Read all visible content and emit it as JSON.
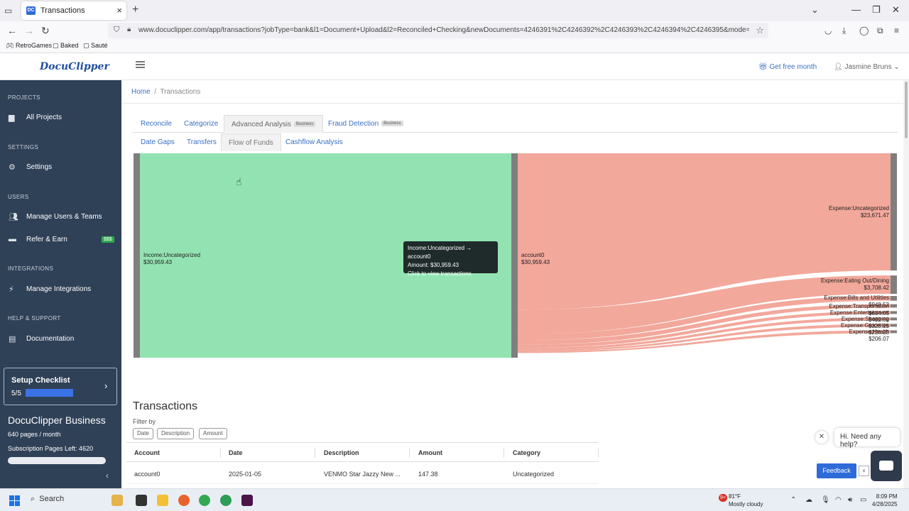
{
  "browser": {
    "tab_title": "Transactions",
    "tab_favicon": "DC",
    "url": "www.docuclipper.com/app/transactions?jobType=bank&l1=Document+Upload&l2=Reconciled+Checking&newDocuments=4246391%2C4246392%2C4246393%2C4246394%2C4246395&mode=analyze&analyze",
    "bookmarks": [
      "RetroGames",
      "Baked",
      "Sauté"
    ]
  },
  "header": {
    "logo": "DocuClipper",
    "get_free": "Get free month",
    "user": "Jasmine Bruns"
  },
  "sidebar": {
    "sections": [
      {
        "title": "PROJECTS",
        "items": [
          "All Projects"
        ]
      },
      {
        "title": "SETTINGS",
        "items": [
          "Settings"
        ]
      },
      {
        "title": "USERS",
        "items": [
          "Manage Users & Teams",
          "Refer & Earn"
        ]
      },
      {
        "title": "INTEGRATIONS",
        "items": [
          "Manage Integrations"
        ]
      },
      {
        "title": "HELP & SUPPORT",
        "items": [
          "Documentation"
        ]
      }
    ],
    "refer_badge": "$$$",
    "checklist_title": "Setup Checklist",
    "checklist_progress": "5/5",
    "checklist_fraction": 1.0,
    "plan_title": "DocuClipper Business",
    "plan_pages": "640 pages / month",
    "plan_left": "Subscription Pages Left: 4620"
  },
  "breadcrumb": {
    "home": "Home",
    "sep": "/",
    "current": "Transactions"
  },
  "tabs_primary": [
    {
      "label": "Reconcile",
      "badge": ""
    },
    {
      "label": "Categorize",
      "badge": ""
    },
    {
      "label": "Advanced Analysis",
      "badge": "Business"
    },
    {
      "label": "Fraud Detection",
      "badge": "Business"
    }
  ],
  "tabs_secondary": [
    "Date Gaps",
    "Transfers",
    "Flow of Funds",
    "Cashflow Analysis"
  ],
  "sankey": {
    "source": {
      "name": "Income:Uncategorized",
      "amount": "$30,959.43"
    },
    "middle": {
      "name": "account0",
      "amount": "$30,959.43"
    },
    "targets": [
      {
        "name": "Expense:Uncategorized",
        "amount": "$23,671.47"
      },
      {
        "name": "Expense:Eating Out/Dining",
        "amount": "$3,708.42"
      },
      {
        "name": "Expense:Bills and Utilities",
        "amount": "$948.53"
      },
      {
        "name": "Expense:Transportation",
        "amount": "$684.05"
      },
      {
        "name": "Expense:Entertainment",
        "amount": "$482.69"
      },
      {
        "name": "Expense:Shopping",
        "amount": "$325.25"
      },
      {
        "name": "Expense:Groceries",
        "amount": "$226.25"
      },
      {
        "name": "Expense:Health",
        "amount": "$206.07"
      }
    ],
    "tooltip": {
      "line1": "Income:Uncategorized → account0",
      "line2": "Amount: $30,959.43",
      "line3": "Click to view transactions"
    },
    "colors": {
      "source": "#92e3b1",
      "target": "#f2a89b",
      "node": "#7f7f7f"
    }
  },
  "transactions": {
    "title": "Transactions",
    "filter_label": "Filter by",
    "filters": [
      "Date",
      "Description",
      "Amount"
    ],
    "columns": [
      "Account",
      "Date",
      "Description",
      "Amount",
      "Category"
    ],
    "rows": [
      [
        "account0",
        "2025-01-05",
        "VENMO Star Jazzy New ...",
        "147.38",
        "Uncategorized"
      ]
    ]
  },
  "widgets": {
    "help_text": "Hi. Need any help?",
    "feedback": "Feedback",
    "feedback_close": "×",
    "help_close": "✕"
  },
  "taskbar": {
    "search": "Search",
    "weather_temp": "81°F",
    "weather_desc": "Mostly cloudy",
    "weather_badge": "9+",
    "time": "8:09 PM",
    "date": "4/28/2025"
  }
}
